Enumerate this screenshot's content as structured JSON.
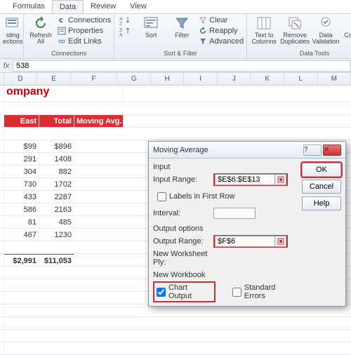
{
  "tabs": [
    "Formulas",
    "Data",
    "Review",
    "View"
  ],
  "active_tab": "Data",
  "ribbon": {
    "ext": {
      "existing": "sting",
      "connections": "ections"
    },
    "refresh": "Refresh\nAll",
    "conn_menu": {
      "connections": "Connections",
      "properties": "Properties",
      "edit": "Edit Links"
    },
    "group_conn": "Connections",
    "sort": "Sort",
    "filter": "Filter",
    "filter_menu": {
      "clear": "Clear",
      "reapply": "Reapply",
      "advanced": "Advanced"
    },
    "group_sort": "Sort & Filter",
    "ttc": "Text to\nColumns",
    "dup": "Remove\nDuplicates",
    "val": "Data\nValidation",
    "cons": "Consolidate",
    "group_tools": "Data Tools"
  },
  "formula_bar": {
    "value": "538"
  },
  "columns": [
    "",
    "D",
    "E",
    "F",
    "G",
    "H",
    "I",
    "J",
    "K",
    "L",
    "M"
  ],
  "title_text": "ompany",
  "headers": {
    "east": "East",
    "total": "Total",
    "avg": "Moving Avg."
  },
  "rows": [
    {
      "east": "$99",
      "total": "$896"
    },
    {
      "east": "291",
      "total": "1408"
    },
    {
      "east": "304",
      "total": "882"
    },
    {
      "east": "730",
      "total": "1702"
    },
    {
      "east": "433",
      "total": "2287"
    },
    {
      "east": "586",
      "total": "2163"
    },
    {
      "east": "81",
      "total": "485"
    },
    {
      "east": "467",
      "total": "1230"
    }
  ],
  "totals": {
    "east": "$2,991",
    "total": "$11,053"
  },
  "dialog": {
    "title": "Moving Average",
    "input_lbl": "Input",
    "input_range_lbl": "Input Range:",
    "input_range": "$E$6:$E$13",
    "labels_first": "Labels in First Row",
    "interval_lbl": "Interval:",
    "interval": "",
    "output_lbl": "Output options",
    "output_range_lbl": "Output Range:",
    "output_range": "$F$6",
    "ws_ply": "New Worksheet Ply:",
    "new_wb": "New Workbook",
    "chart_out": "Chart Output",
    "std_err": "Standard Errors",
    "ok": "OK",
    "cancel": "Cancel",
    "help": "Help"
  }
}
